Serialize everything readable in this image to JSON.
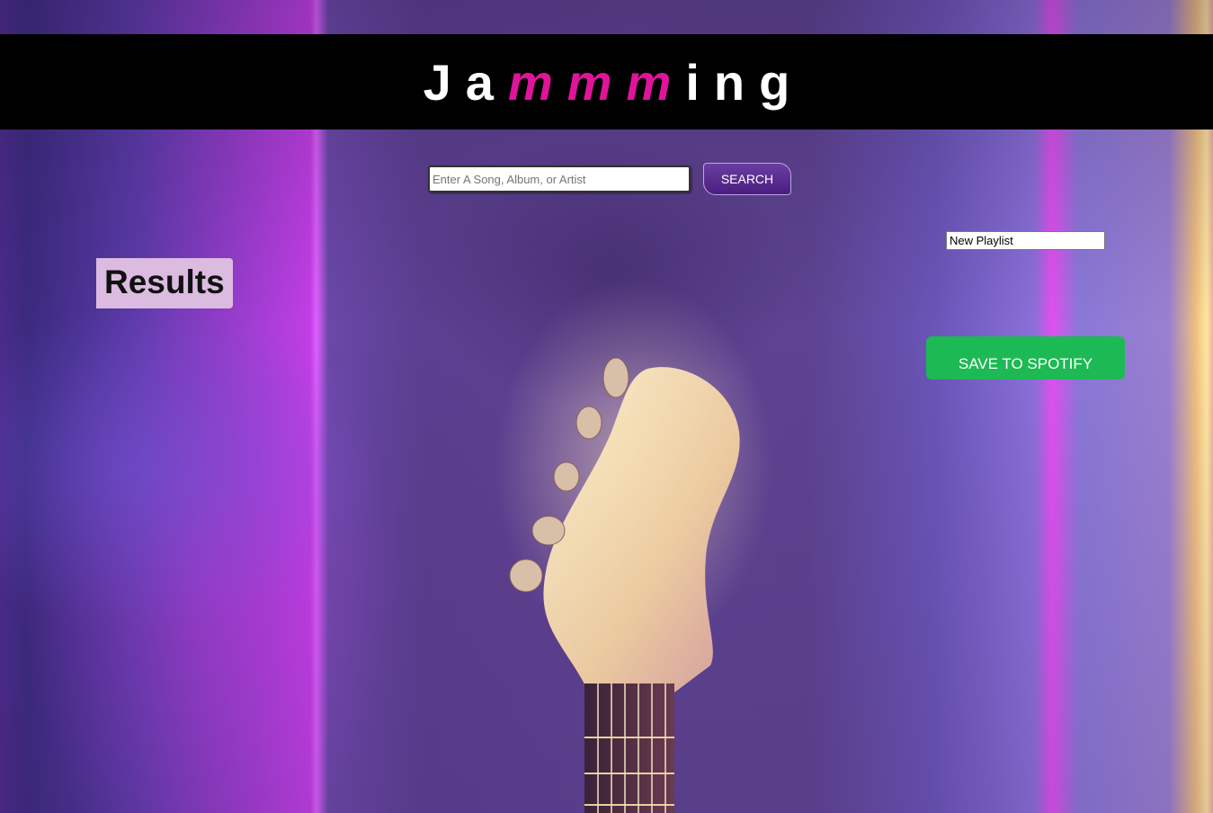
{
  "header": {
    "logo_prefix": "Ja",
    "logo_accent": "mmm",
    "logo_suffix": "ing",
    "accent_color": "#e0149a",
    "background_color": "#000000"
  },
  "search": {
    "placeholder": "Enter A Song, Album, or Artist",
    "value": "",
    "button_label": "SEARCH"
  },
  "results": {
    "title": "Results"
  },
  "playlist": {
    "name_value": "New Playlist",
    "save_label": "SAVE TO SPOTIFY",
    "save_color": "#1db954"
  },
  "background": {
    "image_subject": "guitar-headstock-neon-background"
  }
}
